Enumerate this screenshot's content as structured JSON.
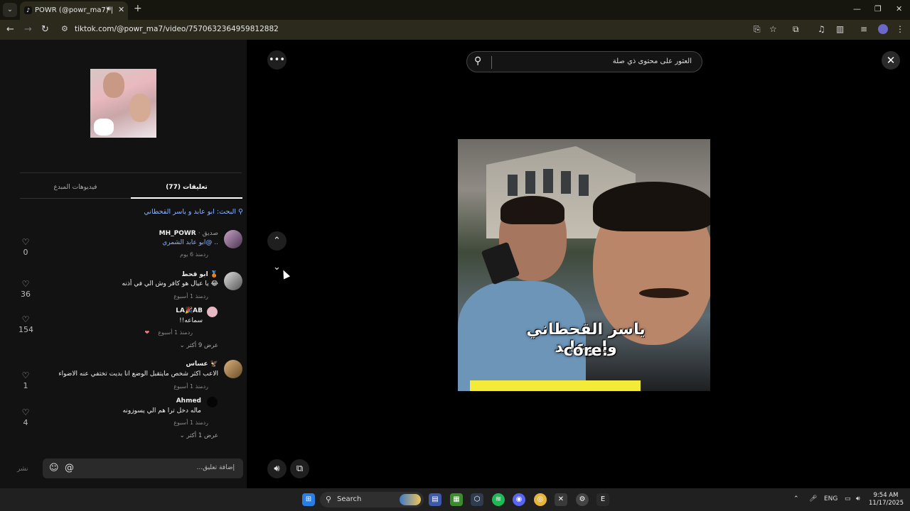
{
  "browser": {
    "tab_title": "POWR (@powr_ma7) | TikTok",
    "url": "tiktok.com/@powr_ma7/video/7570632364959812882"
  },
  "left_panel": {
    "tabs": {
      "comments": "(77) تعليقات",
      "creator_videos": "فيديوهات المبدع"
    },
    "search_suggestion": "البحث: ابو عابد و ياسر القحطاني",
    "comments": [
      {
        "name": "MH_POWR",
        "badge": "· صديق",
        "text": "ابو عابد الشمري@ ..",
        "time": "منذ 6 يوم",
        "reply": "رد",
        "likes": "0"
      },
      {
        "name": "ابو قحط 🥉",
        "text": "يا عيال هو كافر وش الي في أذنه 😂",
        "time": "منذ 1 أسبوع",
        "reply": "رد",
        "likes": "36"
      },
      {
        "name": "LA🎉AB",
        "text": "!!سماعه",
        "time": "منذ 1 أسبوع",
        "reply": "رد",
        "likes": "154",
        "more": "عرض 9 أكثر"
      },
      {
        "name": "عساس 🦅",
        "text": "الاعب اكثر شخص مايتقبل الوضع انا بديت تختفي عنه الاضواء",
        "time": "منذ 1 أسبوع",
        "reply": "رد",
        "likes": "1"
      },
      {
        "name": "Ahmed",
        "text": "ماله دخل ترا هم الي يسوزونه",
        "time": "منذ 1 أسبوع",
        "reply": "رد",
        "likes": "4",
        "more": "عرض 1 أكثر"
      }
    ],
    "input_placeholder": "...إضافة تعليق",
    "post_label": "نشر"
  },
  "video": {
    "search_text": "العثور على محتوى ذي صلة",
    "caption_line1": "ياسر القحطاني وابوعابد",
    "caption_line2": "core:"
  },
  "taskbar": {
    "search_label": "Search",
    "lang": "ENG",
    "time": "9:54 AM",
    "date": "11/17/2025"
  }
}
